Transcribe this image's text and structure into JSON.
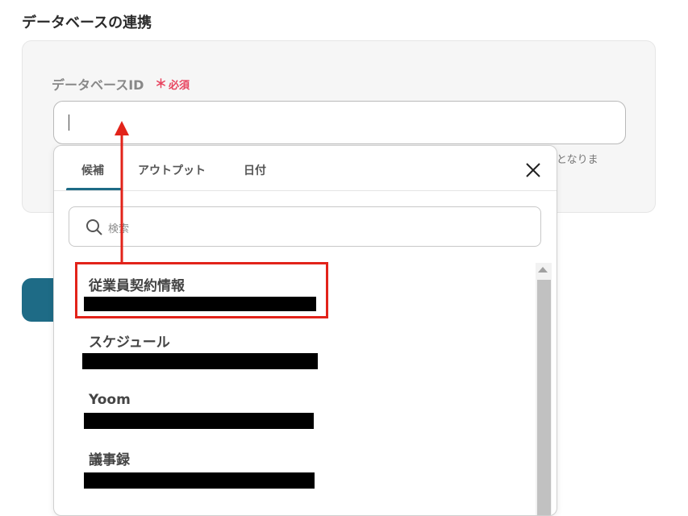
{
  "section": {
    "title": "データベースの連携"
  },
  "field": {
    "label": "データベースID",
    "required_mark": "＊",
    "required_text": "必須",
    "value": "",
    "help_tail": "のとなりま"
  },
  "dropdown": {
    "tabs": [
      {
        "label": "候補",
        "active": true
      },
      {
        "label": "アウトプット",
        "active": false
      },
      {
        "label": "日付",
        "active": false
      }
    ],
    "search_placeholder": "検索",
    "items": [
      {
        "title": "従業員契約情報",
        "highlighted": true
      },
      {
        "title": "スケジュール",
        "highlighted": false
      },
      {
        "title": "Yoom",
        "highlighted": false
      },
      {
        "title": "議事録",
        "highlighted": false
      }
    ]
  },
  "colors": {
    "accent": "#1e6b86",
    "required": "#e8445f",
    "highlight": "#e2231a"
  }
}
